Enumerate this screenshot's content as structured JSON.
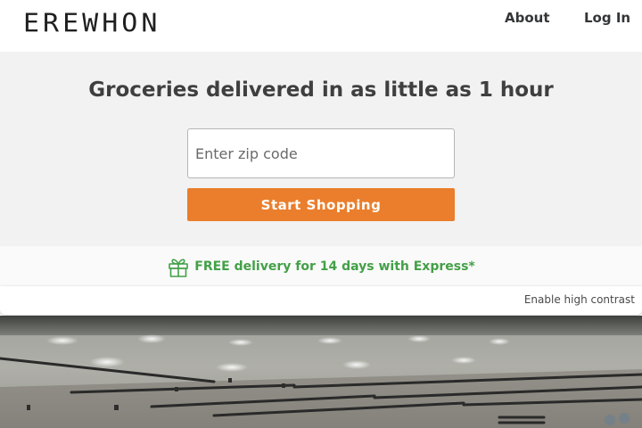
{
  "header": {
    "logo_text": "EREWHON",
    "nav": {
      "about": "About",
      "login": "Log In"
    }
  },
  "hero": {
    "headline": "Groceries delivered in as little as 1 hour",
    "zip_placeholder": "Enter zip code",
    "cta_label": "Start Shopping"
  },
  "promo": {
    "text": "FREE delivery for 14 days with Express*",
    "icon": "gift-icon",
    "color": "#43a047"
  },
  "accessibility": {
    "contrast_label": "Enable high contrast"
  },
  "colors": {
    "accent": "#ea7e2c",
    "hero_background": "#f2f2f2",
    "text": "#343538"
  }
}
